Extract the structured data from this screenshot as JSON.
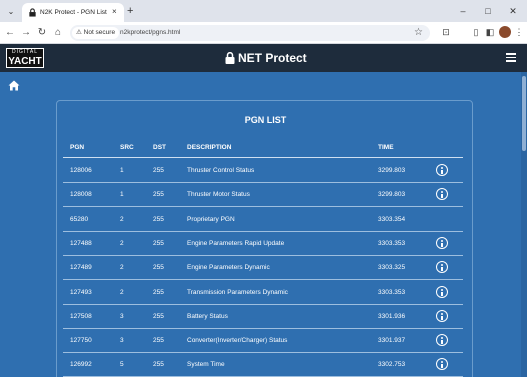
{
  "browser": {
    "tab_title": "N2K Protect - PGN List",
    "security_label": "Not secure",
    "url": "n2kprotect/pgns.html",
    "tab_close": "×",
    "new_tab": "+",
    "minimize": "–",
    "maximize": "□",
    "close": "✕"
  },
  "header": {
    "logo_top": "DIGITAL",
    "logo_bottom": "YACHT",
    "brand": "NET Protect"
  },
  "pgn_list": {
    "title": "PGN LIST",
    "columns": [
      "PGN",
      "SRC",
      "DST",
      "DESCRIPTION",
      "TIME"
    ],
    "rows": [
      {
        "pgn": "128006",
        "src": "1",
        "dst": "255",
        "desc": "Thruster Control Status",
        "time": "3299.803",
        "info": true
      },
      {
        "pgn": "128008",
        "src": "1",
        "dst": "255",
        "desc": "Thruster Motor Status",
        "time": "3299.803",
        "info": true
      },
      {
        "pgn": "65280",
        "src": "2",
        "dst": "255",
        "desc": "Proprietary PGN",
        "time": "3303.354",
        "info": false
      },
      {
        "pgn": "127488",
        "src": "2",
        "dst": "255",
        "desc": "Engine Parameters Rapid Update",
        "time": "3303.353",
        "info": true
      },
      {
        "pgn": "127489",
        "src": "2",
        "dst": "255",
        "desc": "Engine Parameters Dynamic",
        "time": "3303.325",
        "info": true
      },
      {
        "pgn": "127493",
        "src": "2",
        "dst": "255",
        "desc": "Transmission Parameters Dynamic",
        "time": "3303.353",
        "info": true
      },
      {
        "pgn": "127508",
        "src": "3",
        "dst": "255",
        "desc": "Battery Status",
        "time": "3301.936",
        "info": true
      },
      {
        "pgn": "127750",
        "src": "3",
        "dst": "255",
        "desc": "Converter(Inverter/Charger) Status",
        "time": "3301.937",
        "info": true
      },
      {
        "pgn": "126992",
        "src": "5",
        "dst": "255",
        "desc": "System Time",
        "time": "3302.753",
        "info": true
      }
    ]
  },
  "icons": {
    "home": "home-icon",
    "menu": "hamburger-menu-icon",
    "info": "info-icon",
    "lock": "lock-icon"
  },
  "colors": {
    "page_bg": "#2f6fb0",
    "header_bg": "#1e2c3c"
  }
}
